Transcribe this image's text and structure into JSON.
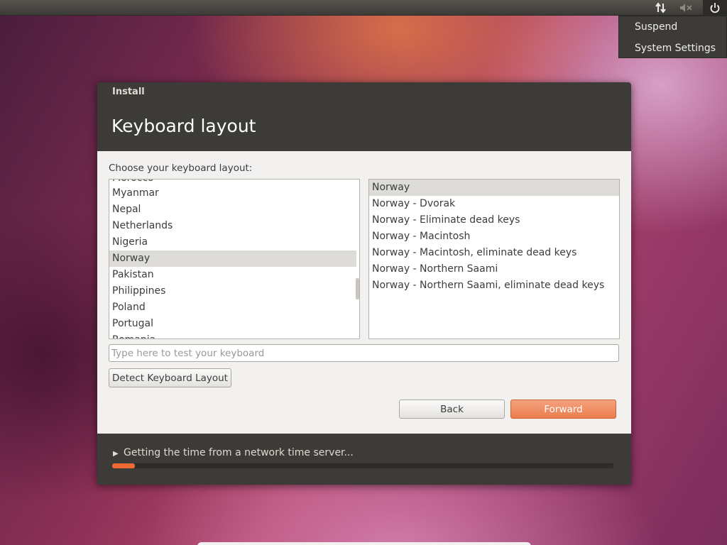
{
  "top_panel": {
    "icons": [
      "network-transfer-icon",
      "sound-muted-icon",
      "power-icon"
    ]
  },
  "power_menu": {
    "items": [
      "Suspend",
      "System Settings"
    ]
  },
  "window": {
    "title": "Install",
    "page_title": "Keyboard layout",
    "prompt": "Choose your keyboard layout:"
  },
  "countries": {
    "items": [
      "Morocco",
      "Myanmar",
      "Nepal",
      "Netherlands",
      "Nigeria",
      "Norway",
      "Pakistan",
      "Philippines",
      "Poland",
      "Portugal",
      "Romania"
    ],
    "selected": "Norway"
  },
  "variants": {
    "items": [
      "Norway",
      "Norway - Dvorak",
      "Norway - Eliminate dead keys",
      "Norway - Macintosh",
      "Norway - Macintosh, eliminate dead keys",
      "Norway - Northern Saami",
      "Norway - Northern Saami, eliminate dead keys"
    ],
    "selected": "Norway"
  },
  "test_field": {
    "placeholder": "Type here to test your keyboard",
    "value": ""
  },
  "buttons": {
    "detect": "Detect Keyboard Layout",
    "back": "Back",
    "forward": "Forward"
  },
  "status": {
    "text": "Getting the time from a network time server...",
    "progress": 0.045
  },
  "colors": {
    "accent": "#ee6a35",
    "forward_button": "#ea7d4e",
    "window_dark": "#3c3b37"
  }
}
